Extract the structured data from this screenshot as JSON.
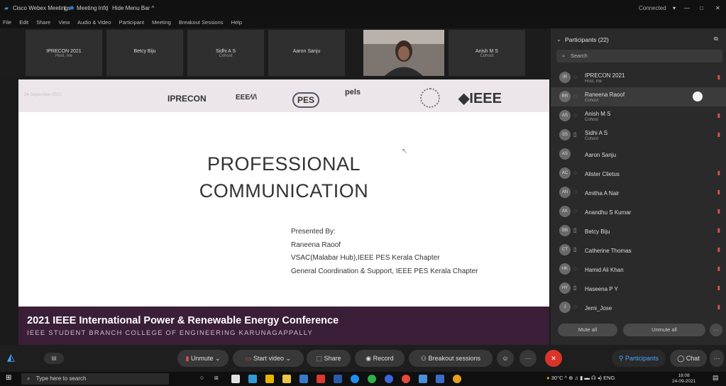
{
  "titlebar": {
    "app_name": "Cisco Webex Meetings",
    "meeting_info": "Meeting Info",
    "hide_menu": "Hide Menu Bar ^",
    "status": "Connected",
    "window_controls": [
      "—",
      "□",
      "✕"
    ]
  },
  "menubar": [
    "File",
    "Edit",
    "Share",
    "View",
    "Audio & Video",
    "Participant",
    "Meeting",
    "Breakout Sessions",
    "Help"
  ],
  "video_strip": [
    {
      "name": "IPRECON 2021",
      "sub": "Host, me"
    },
    {
      "name": "Betcy Biju",
      "sub": ""
    },
    {
      "name": "Sidhi A S",
      "sub": "Cohost"
    },
    {
      "name": "Aaron Sanju",
      "sub": ""
    },
    {
      "name": "",
      "sub": "",
      "is_video": true
    },
    {
      "name": "Anish M S",
      "sub": "Cohost"
    }
  ],
  "slide": {
    "date": "24 September 2021",
    "logos": [
      "IPRECON",
      "EEE",
      "PES",
      "pels",
      "IEEE"
    ],
    "title_line1": "PROFESSIONAL",
    "title_line2": "COMMUNICATION",
    "presenter": [
      "Presented By:",
      "Raneena Raoof",
      "VSAC(Malabar Hub),IEEE PES Kerala Chapter",
      "General Coordination & Support, IEEE PES Kerala Chapter"
    ],
    "footer_title": "2021 IEEE International Power & Renewable Energy Conference",
    "footer_sub": "IEEE STUDENT BRANCH COLLEGE OF ENGINEERING KARUNAGAPPALLY"
  },
  "participants": {
    "title": "Participants (22)",
    "search_placeholder": "Search",
    "list": [
      {
        "initials": "IR",
        "name": "IPRECON 2021",
        "sub": "Host, me",
        "selected": false
      },
      {
        "initials": "RR",
        "name": "Raneena Raoof",
        "sub": "Cohost",
        "selected": true
      },
      {
        "initials": "AS",
        "name": "Anish M S",
        "sub": "Cohost",
        "selected": false
      },
      {
        "initials": "SS",
        "name": "Sidhi A S",
        "sub": "Cohost",
        "selected": false
      },
      {
        "initials": "AS",
        "name": "Aaron Sanju",
        "sub": "",
        "selected": false
      },
      {
        "initials": "AC",
        "name": "Alister Clietus",
        "sub": "",
        "selected": false
      },
      {
        "initials": "AN",
        "name": "Amitha A Nair",
        "sub": "",
        "selected": false
      },
      {
        "initials": "AK",
        "name": "Anandhu S Kumar",
        "sub": "",
        "selected": false
      },
      {
        "initials": "BB",
        "name": "Betcy Biju",
        "sub": "",
        "selected": false
      },
      {
        "initials": "CT",
        "name": "Catherine Thomas",
        "sub": "",
        "selected": false
      },
      {
        "initials": "HK",
        "name": "Hamid Ali Khan",
        "sub": "",
        "selected": false
      },
      {
        "initials": "HY",
        "name": "Haseena P Y",
        "sub": "",
        "selected": false
      },
      {
        "initials": "J",
        "name": "Jemi_Jose",
        "sub": "",
        "selected": false
      }
    ],
    "mute_all": "Mute all",
    "unmute_all": "Unmute all"
  },
  "controls": {
    "unmute": "Unmute",
    "start_video": "Start video",
    "share": "Share",
    "record": "Record",
    "breakout": "Breakout sessions",
    "participants": "Participants",
    "chat": "Chat",
    "more": "···"
  },
  "taskbar": {
    "search_placeholder": "Type here to search",
    "temperature": "30°C",
    "lang": "ENG",
    "time": "18:08",
    "date": "24-09-2021"
  },
  "colors": {
    "slide_footer": "#3b1e37",
    "end_button": "#d9342b",
    "webex_blue": "#1f8ef1"
  }
}
